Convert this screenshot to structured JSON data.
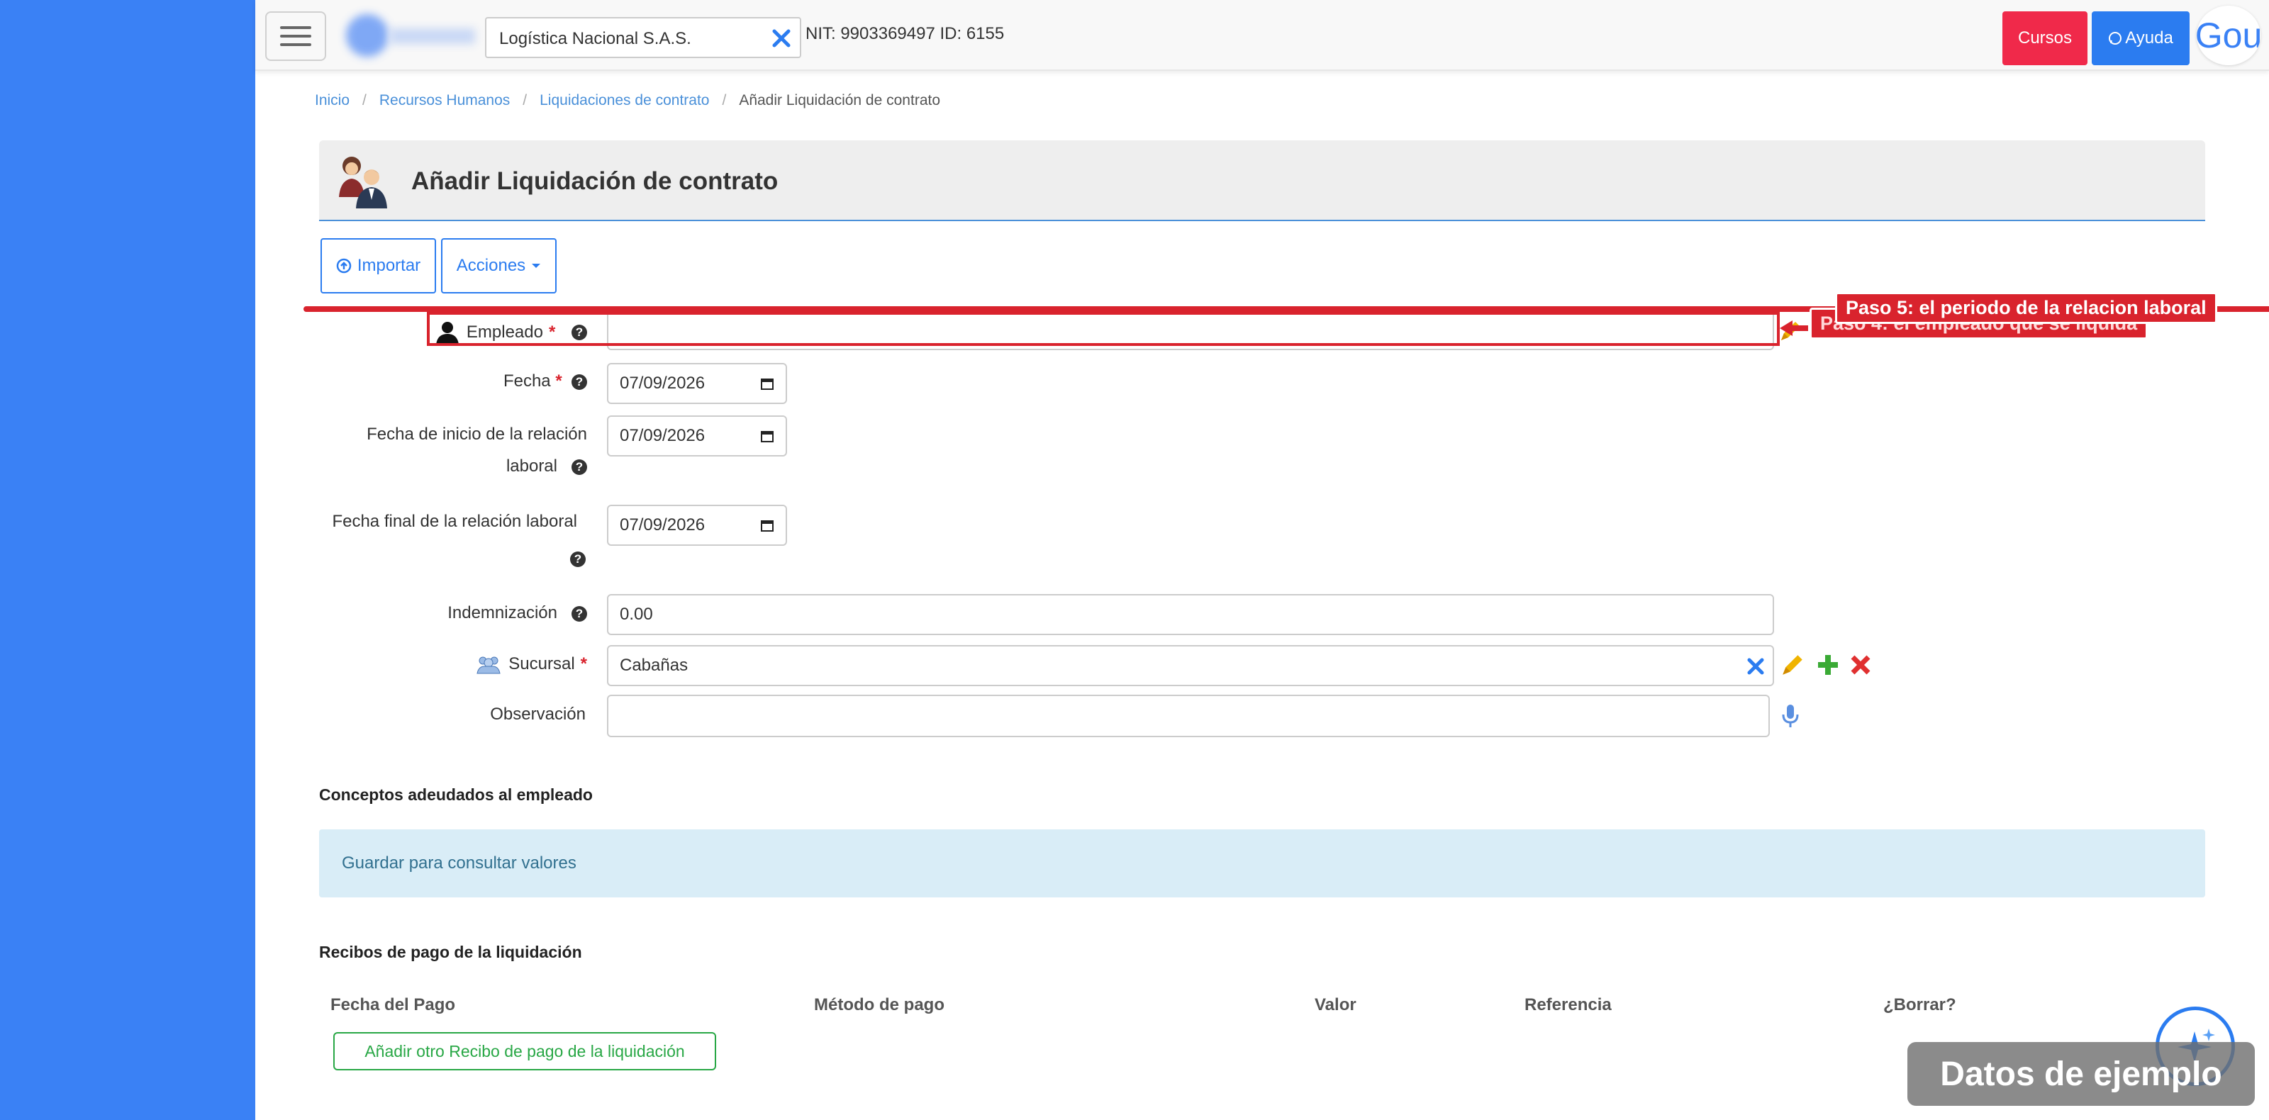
{
  "topbar": {
    "company": "Logística Nacional S.A.S.",
    "nit": "NIT: 9903369497 ID: 6155",
    "cursos": "Cursos",
    "ayuda": "Ayuda",
    "avatar_text": "Gou"
  },
  "breadcrumb": [
    "Inicio",
    "Recursos Humanos",
    "Liquidaciones de contrato",
    "Añadir Liquidación de contrato"
  ],
  "page_title": "Añadir Liquidación de contrato",
  "actions": {
    "importar": "Importar",
    "acciones": "Acciones"
  },
  "form": {
    "empleado": {
      "label": "Empleado",
      "value": ""
    },
    "fecha": {
      "label": "Fecha",
      "value": "07/09/2026"
    },
    "fecha_inicio": {
      "label_line1": "Fecha de inicio de la relación",
      "label_line2": "laboral",
      "value": "07/09/2026"
    },
    "fecha_final": {
      "label": "Fecha final de la relación laboral",
      "value": "07/09/2026"
    },
    "indemnizacion": {
      "label": "Indemnización",
      "value": "0.00"
    },
    "sucursal": {
      "label": "Sucursal",
      "value": "Cabañas"
    },
    "observacion": {
      "label": "Observación",
      "value": ""
    }
  },
  "conceptos": {
    "title": "Conceptos adeudados al empleado",
    "info": "Guardar para consultar valores"
  },
  "recibos": {
    "title": "Recibos de pago de la liquidación",
    "columns": [
      "Fecha del Pago",
      "Método de pago",
      "Valor",
      "Referencia",
      "¿Borrar?"
    ],
    "add_button": "Añadir otro Recibo de pago de la liquidación"
  },
  "annotations": {
    "paso5": "Paso 5: el periodo de la relacion laboral",
    "paso4": "Paso 4: el empleado que se liquida"
  },
  "watermark": "Datos de ejemplo",
  "colors": {
    "sidebar": "#3a81f5",
    "primary": "#2b7cf0",
    "danger": "#f0294a",
    "annotation": "#d9232d",
    "success": "#28a745"
  }
}
